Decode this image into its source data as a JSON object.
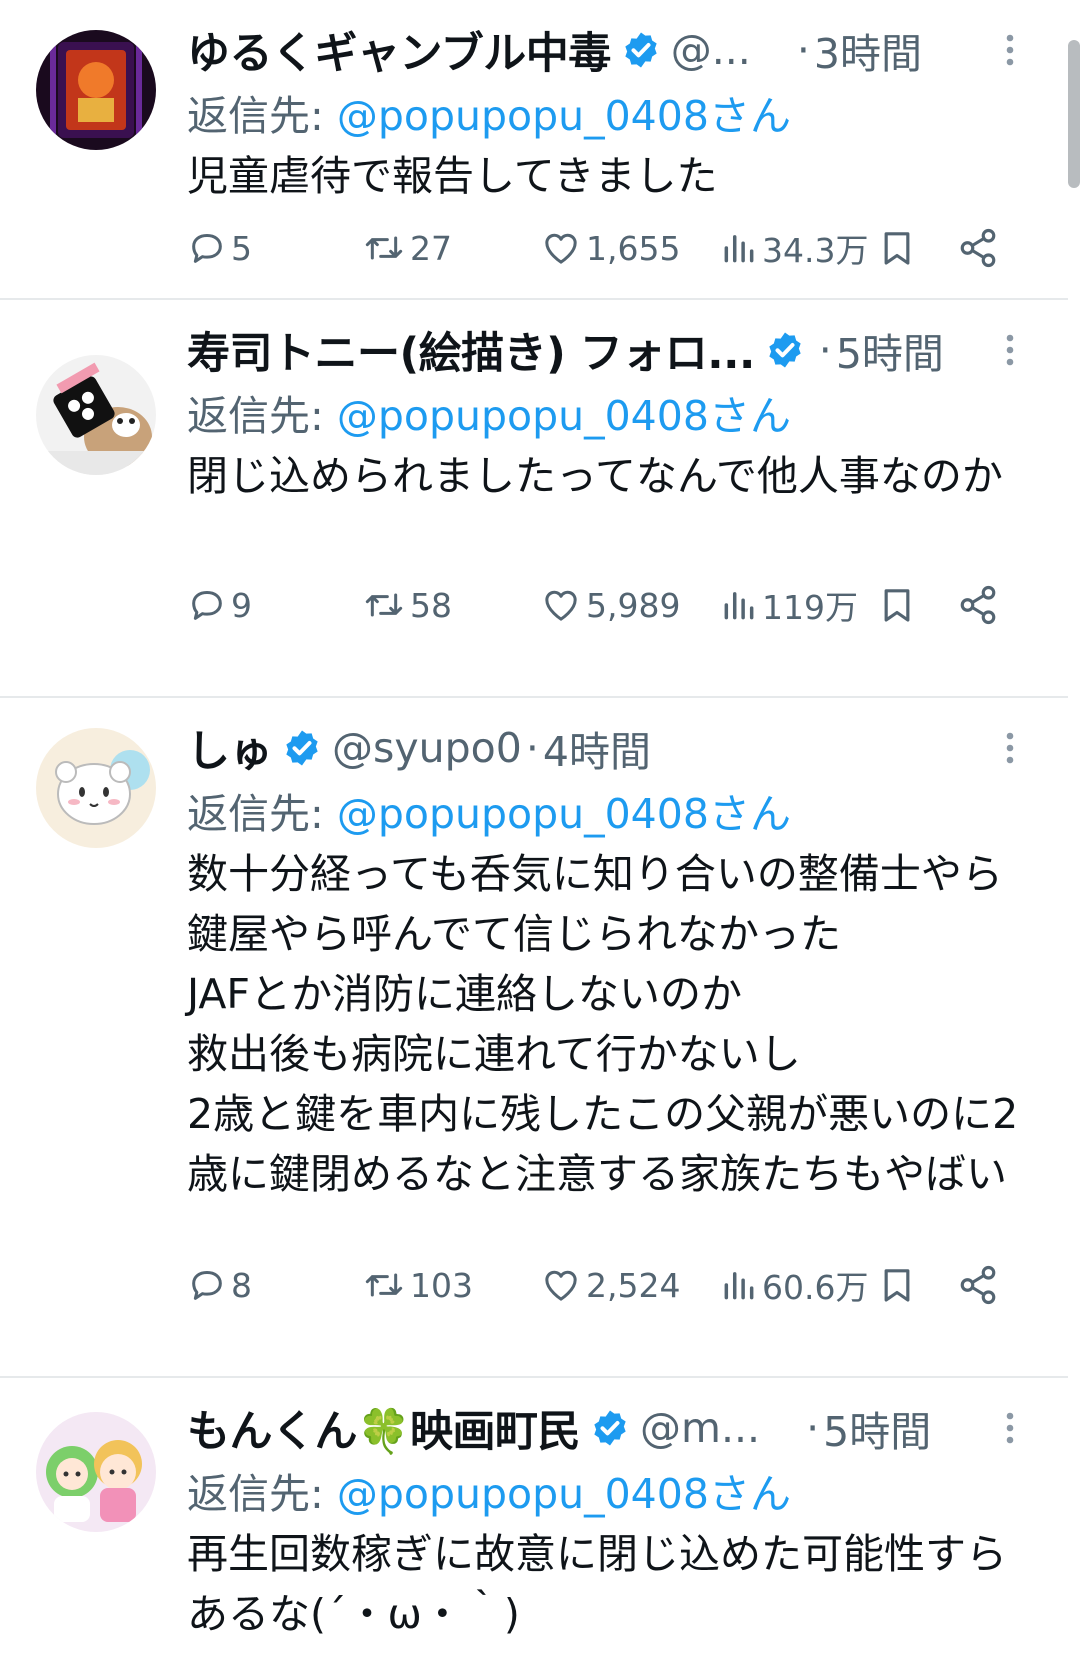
{
  "tweets": [
    {
      "display_name": "ゆるくギャンブル中毒",
      "handle": "@...",
      "dot": "·",
      "time": "3時間",
      "reply_prefix": "返信先: ",
      "reply_mention": "@popupopu_0408さん",
      "body": "児童虐待で報告してきました",
      "replies": "5",
      "retweets": "27",
      "likes": "1,655",
      "views": "34.3万"
    },
    {
      "display_name": "寿司トニー(絵描き) フォロ...",
      "handle": "",
      "dot": "·",
      "time": "5時間",
      "reply_prefix": "返信先: ",
      "reply_mention": "@popupopu_0408さん",
      "body": "閉じ込められましたってなんで他人事なのか",
      "replies": "9",
      "retweets": "58",
      "likes": "5,989",
      "views": "119万"
    },
    {
      "display_name": "しゅ",
      "handle": "@syupo0",
      "dot": "·",
      "time": "4時間",
      "reply_prefix": "返信先: ",
      "reply_mention": "@popupopu_0408さん",
      "body": "数十分経っても呑気に知り合いの整備士やら鍵屋やら呼んでて信じられなかった\nJAFとか消防に連絡しないのか\n救出後も病院に連れて行かないし\n2歳と鍵を車内に残したこの父親が悪いのに2歳に鍵閉めるなと注意する家族たちもやばい",
      "replies": "8",
      "retweets": "103",
      "likes": "2,524",
      "views": "60.6万"
    },
    {
      "display_name": "もんくん🍀映画町民",
      "handle": "@m...",
      "dot": "·",
      "time": "5時間",
      "reply_prefix": "返信先: ",
      "reply_mention": "@popupopu_0408さん",
      "body": "再生回数稼ぎに故意に閉じ込めた可能性すらあるな(´・ω・｀)"
    }
  ],
  "colors": {
    "text": "#0f1419",
    "secondary": "#536471",
    "link": "#1d9bf0",
    "verified": "#1d9bf0",
    "divider": "#e6e9eb"
  },
  "icons": {
    "reply": "speech-bubble-icon",
    "retweet": "retweet-arrows-icon",
    "like": "heart-icon",
    "views": "bar-chart-icon",
    "bookmark": "bookmark-icon",
    "share": "share-icon",
    "more": "vertical-ellipsis-icon",
    "verified": "verified-badge-icon"
  }
}
